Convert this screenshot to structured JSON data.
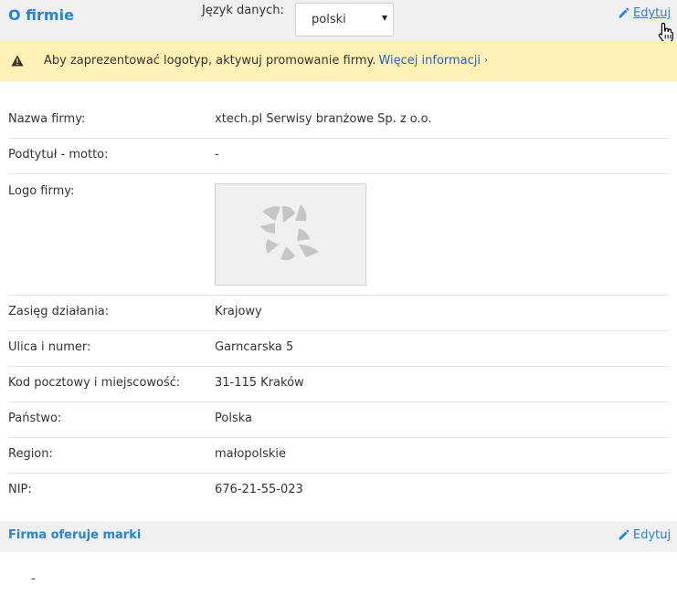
{
  "header": {
    "title": "O firmie",
    "language_label": "Język danych:",
    "language_value": "polski",
    "edit_label": "Edytuj"
  },
  "notice": {
    "message": "Aby zaprezentować logotyp, aktywuj promowanie firmy.",
    "link": "Więcej informacji",
    "chevron": "›",
    "color": "#fff1b3"
  },
  "fields": [
    {
      "label": "Nazwa firmy:",
      "value": "xtech.pl Serwisy branżowe Sp. z o.o."
    },
    {
      "label": "Podtytuł - motto:",
      "value": "-"
    },
    {
      "label": "Logo firmy:",
      "value": ""
    },
    {
      "label": "Zasięg działania:",
      "value": "Krajowy"
    },
    {
      "label": "Ulica i numer:",
      "value": "Garncarska 5"
    },
    {
      "label": "Kod pocztowy i miejscowość:",
      "value": "31-115 Kraków"
    },
    {
      "label": "Państwo:",
      "value": "Polska"
    },
    {
      "label": "Region:",
      "value": "małopolskie"
    },
    {
      "label": "NIP:",
      "value": "676-21-55-023"
    }
  ],
  "brands": {
    "title": "Firma oferuje marki",
    "edit_label": "Edytuj",
    "value": "-"
  },
  "icons": {
    "edit": "pencil-icon",
    "warning": "warning-icon",
    "logo_placeholder": "logo-placeholder-icon",
    "cursor": "hand-cursor-icon"
  },
  "colors": {
    "accent": "#2683d6",
    "link": "#2264c6",
    "header_bg": "#f0f0f0"
  }
}
